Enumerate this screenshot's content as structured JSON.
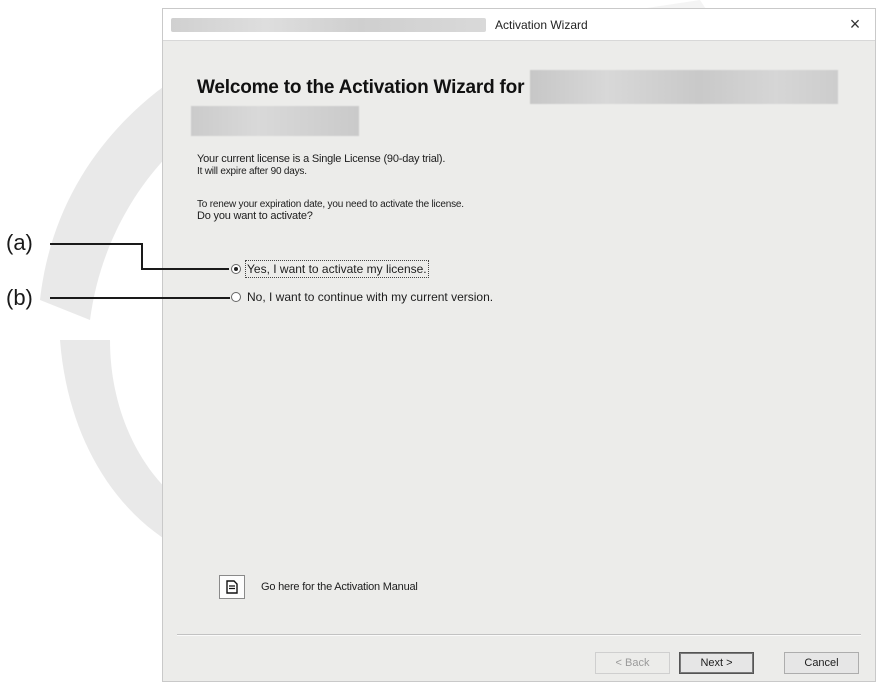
{
  "window": {
    "title": "Activation Wizard",
    "close_glyph": "×",
    "close_icon": "close-icon"
  },
  "content": {
    "heading": "Welcome to the Activation Wizard for",
    "license_line1": "Your current license is a Single License (90-day trial).",
    "license_line2": "It will expire after 90 days.",
    "renew_line1": "To renew your expiration date, you need to activate the license.",
    "renew_line2": "Do you want to activate?"
  },
  "options": [
    {
      "label": "Yes, I want to activate my license.",
      "checked": true
    },
    {
      "label": "No, I want to continue with my current version.",
      "checked": false
    }
  ],
  "manual": {
    "label": "Go here for the Activation Manual",
    "icon": "document-icon"
  },
  "buttons": {
    "back": "< Back",
    "next": "Next >",
    "cancel": "Cancel"
  },
  "callouts": {
    "a": "(a)",
    "b": "(b)"
  }
}
